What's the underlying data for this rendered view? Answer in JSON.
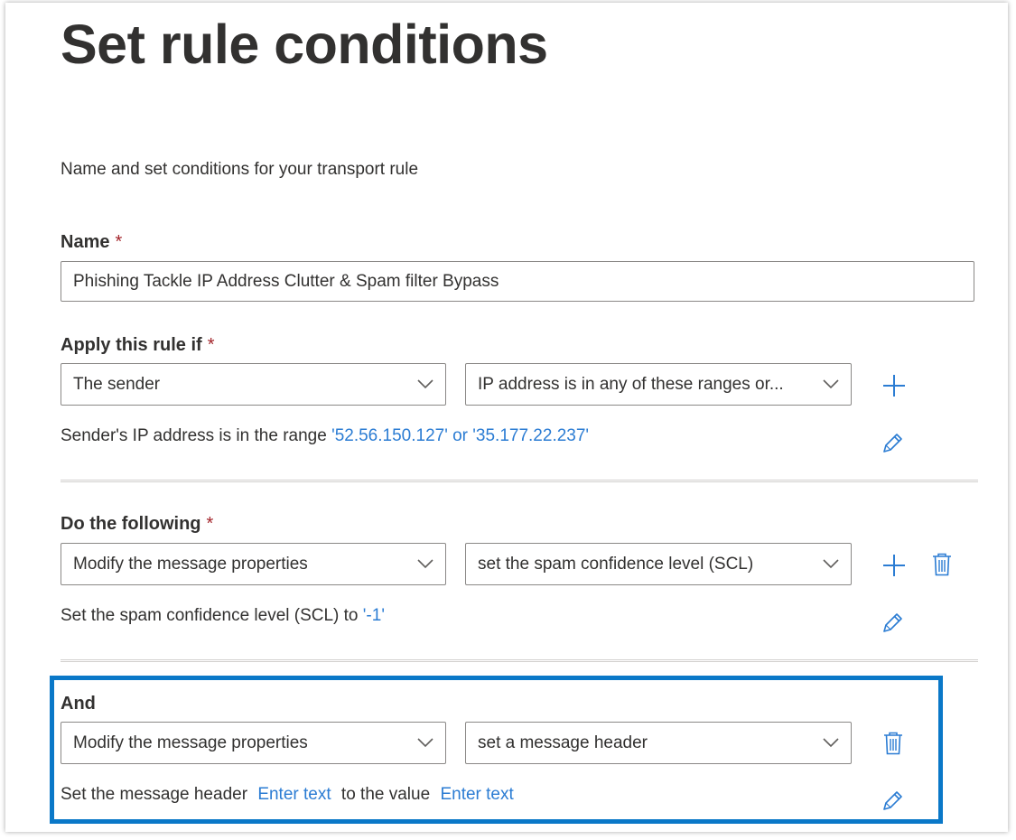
{
  "title": "Set rule conditions",
  "subtitle": "Name and set conditions for your transport rule",
  "required_marker": "*",
  "name_section": {
    "label": "Name",
    "value": "Phishing Tackle IP Address Clutter & Spam filter Bypass"
  },
  "apply_section": {
    "label": "Apply this rule if",
    "dropdown1": "The sender",
    "dropdown2": "IP address is in any of these ranges or...",
    "desc_prefix": "Sender's IP address is in the range ",
    "desc_link": "'52.56.150.127' or '35.177.22.237'"
  },
  "do_section": {
    "label": "Do the following",
    "dropdown1": "Modify the message properties",
    "dropdown2": "set the spam confidence level (SCL)",
    "desc_prefix": "Set the spam confidence level (SCL) to ",
    "desc_link": "'-1'"
  },
  "and_section": {
    "label": "And",
    "dropdown1": "Modify the message properties",
    "dropdown2": "set a message header",
    "desc_prefix": "Set the message header",
    "desc_link1": "Enter text",
    "desc_middle": "to the value",
    "desc_link2": "Enter text"
  },
  "icons": {
    "add": "plus-icon",
    "edit": "pencil-icon",
    "delete": "trash-icon",
    "dropdown": "chevron-down-icon"
  },
  "colors": {
    "link": "#2b7cd3",
    "required": "#a4262c",
    "highlight_border": "#0a78c8",
    "text": "#323130"
  }
}
